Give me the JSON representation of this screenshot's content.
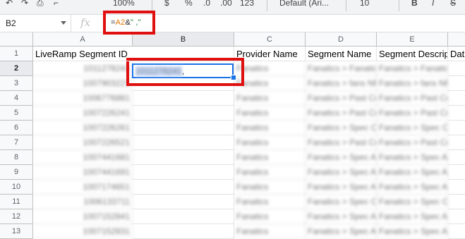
{
  "toolbar": {
    "zoom": "100%",
    "currency_symbol": "$",
    "percent_symbol": "%",
    "decimal_decrease": ".0",
    "decimal_increase": ".00",
    "format_more": "123",
    "font": "Default (Ari...",
    "font_size": "10",
    "bold": "B"
  },
  "formula_bar": {
    "cell_ref": "B2",
    "fx_label": "fx",
    "formula_prefix": "=",
    "formula_ref": "A2",
    "formula_op": "&",
    "formula_string": "\" ,\""
  },
  "columns": [
    "A",
    "B",
    "C",
    "D",
    "E"
  ],
  "header_row": [
    "LiveRamp Segment ID",
    "",
    "Provider Name",
    "Segment Name",
    "Segment Descripti",
    "Dat"
  ],
  "rows": [
    "1",
    "2",
    "3",
    "4",
    "5",
    "6",
    "7",
    "8",
    "9",
    "10",
    "11",
    "12",
    "13"
  ],
  "col_a_values": [
    "1011278241",
    "1007903221",
    "1006776881",
    "1007226241",
    "1007226261",
    "1007226521",
    "1007441681",
    "1007441691",
    "1007174651",
    "1006133711",
    "1007152841",
    "1007152831"
  ],
  "active_cell": {
    "value_highlight": "1011278241",
    "value_tail": ","
  },
  "provider_names": [
    "Fanatics",
    "Fanatics",
    "Fanatics",
    "Fanatics",
    "Fanatics",
    "Fanatics",
    "Fanatics",
    "Fanatics",
    "Fanatics",
    "Fanatics",
    "Fanatics",
    "Fanatics"
  ],
  "segment_names": [
    "Fanatics > Fanatics_Amazon_NFL_ca",
    "Fanatics > fans NFL past Season Pa",
    "Fanatics > Past Consumers who hav",
    "Fanatics > Past Consumers who hav",
    "Fanatics > Spec Consumers who hav",
    "Fanatics > Past Consumers who hav",
    "Fanatics > Spec A segment that con",
    "Fanatics > Spec A segment that con",
    "Fanatics > Spec A segment that con",
    "Fanatics > Spec Consumers who hav",
    "Fanatics > Spec A segment that con",
    "Fanatics > Spec A segment that con"
  ]
}
